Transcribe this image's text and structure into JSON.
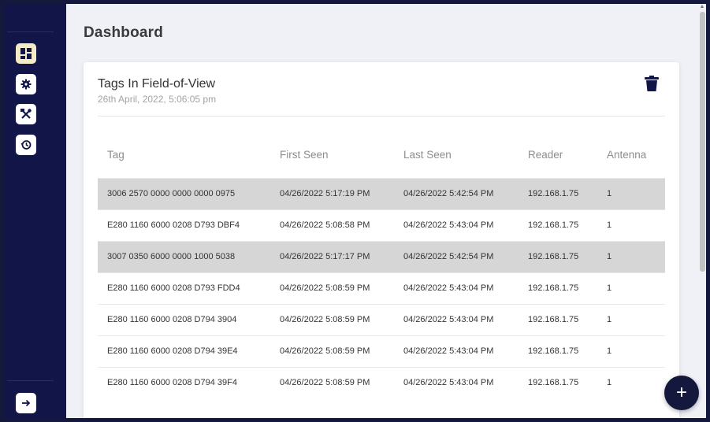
{
  "page": {
    "title": "Dashboard"
  },
  "sidebar": {
    "items": [
      {
        "name": "dashboard",
        "icon": "dashboard-icon",
        "active": true
      },
      {
        "name": "settings",
        "icon": "gear-icon",
        "active": false
      },
      {
        "name": "tools",
        "icon": "tools-icon",
        "active": false
      },
      {
        "name": "history",
        "icon": "history-icon",
        "active": false
      }
    ],
    "bottom_item": {
      "name": "logout",
      "icon": "arrow-right-icon"
    }
  },
  "card": {
    "title": "Tags In Field-of-View",
    "subtitle": "26th April, 2022, 5:06:05 pm",
    "trash_icon": "trash-icon"
  },
  "table": {
    "columns": [
      "Tag",
      "First Seen",
      "Last Seen",
      "Reader",
      "Antenna"
    ],
    "rows": [
      {
        "tag": "3006 2570 0000 0000 0000 0975",
        "first_seen": "04/26/2022 5:17:19 PM",
        "last_seen": "04/26/2022 5:42:54 PM",
        "reader": "192.168.1.75",
        "antenna": "1",
        "highlighted": true
      },
      {
        "tag": "E280 1160 6000 0208 D793 DBF4",
        "first_seen": "04/26/2022 5:08:58 PM",
        "last_seen": "04/26/2022 5:43:04 PM",
        "reader": "192.168.1.75",
        "antenna": "1",
        "highlighted": false
      },
      {
        "tag": "3007 0350 6000 0000 1000 5038",
        "first_seen": "04/26/2022 5:17:17 PM",
        "last_seen": "04/26/2022 5:42:54 PM",
        "reader": "192.168.1.75",
        "antenna": "1",
        "highlighted": true
      },
      {
        "tag": "E280 1160 6000 0208 D793 FDD4",
        "first_seen": "04/26/2022 5:08:59 PM",
        "last_seen": "04/26/2022 5:43:04 PM",
        "reader": "192.168.1.75",
        "antenna": "1",
        "highlighted": false
      },
      {
        "tag": "E280 1160 6000 0208 D794 3904",
        "first_seen": "04/26/2022 5:08:59 PM",
        "last_seen": "04/26/2022 5:43:04 PM",
        "reader": "192.168.1.75",
        "antenna": "1",
        "highlighted": false
      },
      {
        "tag": "E280 1160 6000 0208 D794 39E4",
        "first_seen": "04/26/2022 5:08:59 PM",
        "last_seen": "04/26/2022 5:43:04 PM",
        "reader": "192.168.1.75",
        "antenna": "1",
        "highlighted": false
      },
      {
        "tag": "E280 1160 6000 0208 D794 39F4",
        "first_seen": "04/26/2022 5:08:59 PM",
        "last_seen": "04/26/2022 5:43:04 PM",
        "reader": "192.168.1.75",
        "antenna": "1",
        "highlighted": false
      }
    ]
  },
  "fab": {
    "label": "+",
    "icon": "plus-icon"
  },
  "colors": {
    "sidebar_bg": "#111547",
    "active_nav_bg": "#f3ebc6",
    "page_bg": "#f0f1f7",
    "highlight_row": "#d6d6d6",
    "fab_bg": "#15183d"
  }
}
